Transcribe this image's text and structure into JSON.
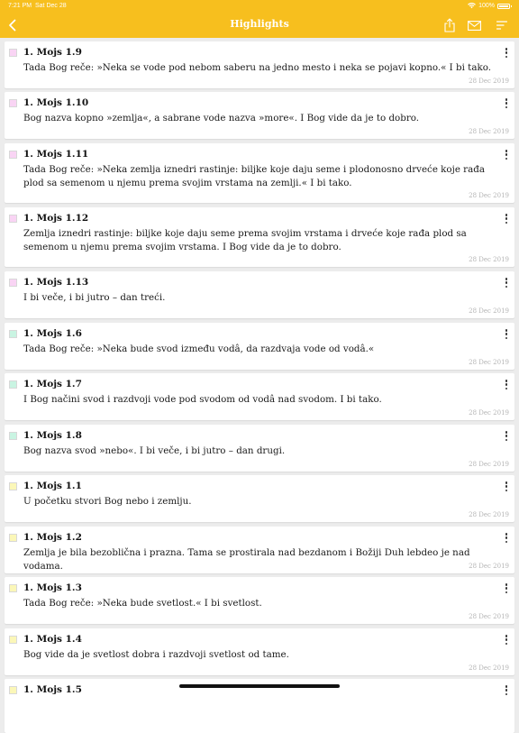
{
  "status_bar": {
    "time": "7:21 PM",
    "date": "Sat Dec 28",
    "battery": "100%"
  },
  "header": {
    "title": "Highlights"
  },
  "colors": {
    "accent": "#f7bf1e",
    "pink": "#f9d4f4",
    "green": "#c9f4e2",
    "yellow": "#fbf7b8"
  },
  "highlights": [
    {
      "ref": "1. Mojs 1.9",
      "text": "Tada Bog reče: »Neka se vode pod nebom saberu na jedno mesto i neka se pojavi kopno.« I bi tako.",
      "date": "28 Dec 2019",
      "color": "#f9d4f4"
    },
    {
      "ref": "1. Mojs 1.10",
      "text": "Bog nazva kopno »zemlja«, a sabrane vode nazva »more«. I Bog vide da je to dobro.",
      "date": "28 Dec 2019",
      "color": "#f9d4f4"
    },
    {
      "ref": "1. Mojs 1.11",
      "text": "Tada Bog reče: »Neka zemlja iznedri rastinje: biljke koje daju seme i plodonosno drveće koje rađa plod sa semenom u njemu prema svojim vrstama na zemlji.« I bi tako.",
      "date": "28 Dec 2019",
      "color": "#f9d4f4"
    },
    {
      "ref": "1. Mojs 1.12",
      "text": "Zemlja iznedri rastinje: biljke koje daju seme prema svojim vrstama i drveće koje rađa plod sa semenom u njemu prema svojim vrstama. I Bog vide da je to dobro.",
      "date": "28 Dec 2019",
      "color": "#f9d4f4"
    },
    {
      "ref": "1. Mojs 1.13",
      "text": "I bi veče, i bi jutro – dan treći.",
      "date": "28 Dec 2019",
      "color": "#f9d4f4"
    },
    {
      "ref": "1. Mojs 1.6",
      "text": "Tada Bog reče: »Neka bude svod između vodâ, da razdvaja vode od vodâ.«",
      "date": "28 Dec 2019",
      "color": "#c9f4e2"
    },
    {
      "ref": "1. Mojs 1.7",
      "text": "I Bog načini svod i razdvoji vode pod svodom od vodâ nad svodom. I bi tako.",
      "date": "28 Dec 2019",
      "color": "#c9f4e2"
    },
    {
      "ref": "1. Mojs 1.8",
      "text": "Bog nazva svod »nebo«. I bi veče, i bi jutro – dan drugi.",
      "date": "28 Dec 2019",
      "color": "#c9f4e2"
    },
    {
      "ref": "1. Mojs 1.1",
      "text": "U početku stvori Bog nebo i zemlju.",
      "date": "28 Dec 2019",
      "color": "#fbf7b8"
    },
    {
      "ref": "1. Mojs 1.2",
      "text": "Zemlja je bila bezoblična i prazna. Tama se prostirala nad bezdanom i Božiji Duh lebdeo je nad vodama.",
      "date": "28 Dec 2019",
      "color": "#fbf7b8"
    },
    {
      "ref": "1. Mojs 1.3",
      "text": "Tada Bog reče: »Neka bude svetlost.« I bi svetlost.",
      "date": "28 Dec 2019",
      "color": "#fbf7b8"
    },
    {
      "ref": "1. Mojs 1.4",
      "text": "Bog vide da je svetlost dobra i razdvoji svetlost od tame.",
      "date": "28 Dec 2019",
      "color": "#fbf7b8"
    },
    {
      "ref": "1. Mojs 1.5",
      "text": "",
      "date": "",
      "color": "#fbf7b8"
    }
  ]
}
